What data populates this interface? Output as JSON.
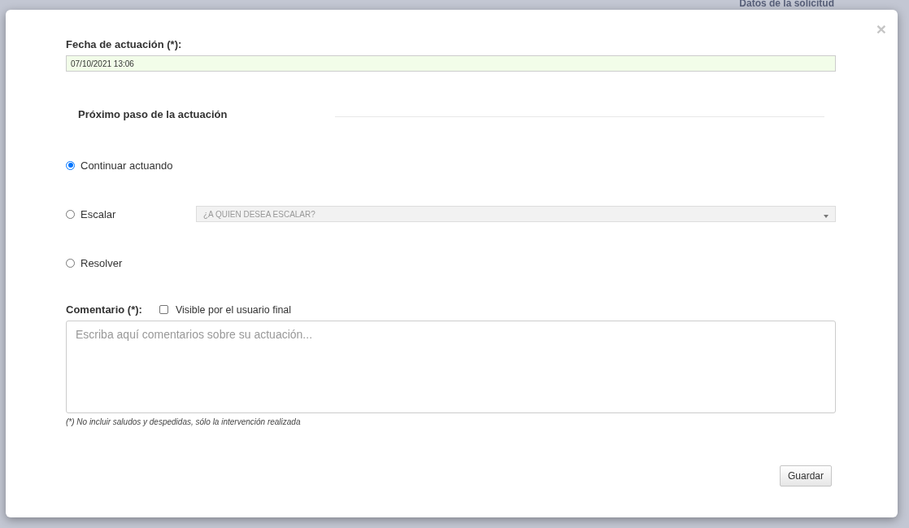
{
  "background": {
    "panel_title": "Datos de la solicitud"
  },
  "dialog": {
    "close": "×",
    "date_field": {
      "label": "Fecha de actuación (*):",
      "value": "07/10/2021 13:06"
    },
    "section_title": "Próximo paso de la actuación",
    "options": [
      {
        "label": "Continuar actuando",
        "selected": true
      },
      {
        "label": "Escalar",
        "selected": false,
        "dropdown": {
          "placeholder": "¿A QUIEN DESEA ESCALAR?",
          "disabled": true
        }
      },
      {
        "label": "Resolver",
        "selected": false
      }
    ],
    "comment": {
      "label": "Comentario (*):",
      "visible_checkbox": {
        "label": "Visible por el usuario final",
        "checked": false
      },
      "placeholder": "Escriba aquí comentarios sobre su actuación...",
      "note": "(*) No incluir saludos y despedidas, sólo la intervención realizada"
    },
    "save_button": "Guardar"
  }
}
